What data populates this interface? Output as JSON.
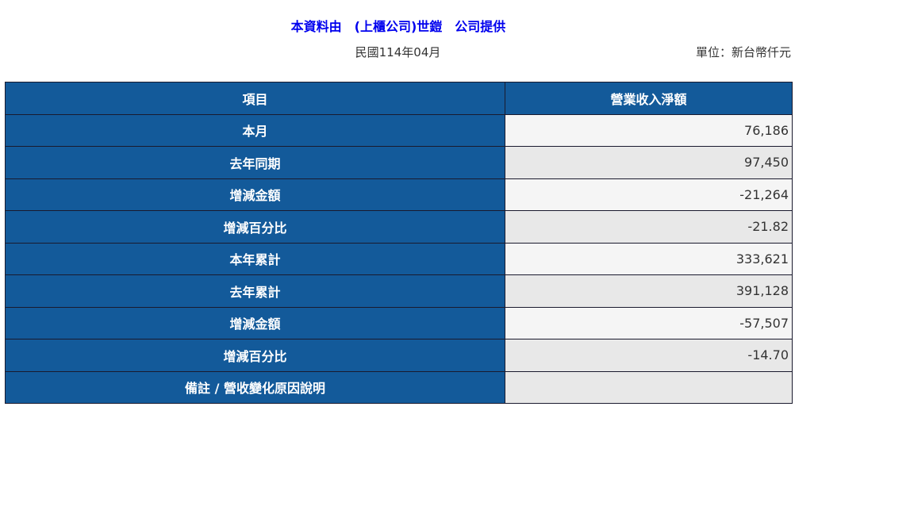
{
  "header": {
    "title": "本資料由　(上櫃公司)世鎧　公司提供",
    "period": "民國114年04月",
    "unit": "單位：新台幣仟元"
  },
  "table": {
    "col_item": "項目",
    "col_revenue": "營業收入淨額",
    "rows": [
      {
        "label": "本月",
        "value": "76,186"
      },
      {
        "label": "去年同期",
        "value": "97,450"
      },
      {
        "label": "增減金額",
        "value": "-21,264"
      },
      {
        "label": "增減百分比",
        "value": "-21.82"
      },
      {
        "label": "本年累計",
        "value": "333,621"
      },
      {
        "label": "去年累計",
        "value": "391,128"
      },
      {
        "label": "增減金額",
        "value": "-57,507"
      },
      {
        "label": "增減百分比",
        "value": "-14.70"
      },
      {
        "label": "備註 / 營收變化原因說明",
        "value": ""
      }
    ]
  },
  "colors": {
    "header_bg": "#135a9a",
    "title_text": "#0000ee"
  }
}
